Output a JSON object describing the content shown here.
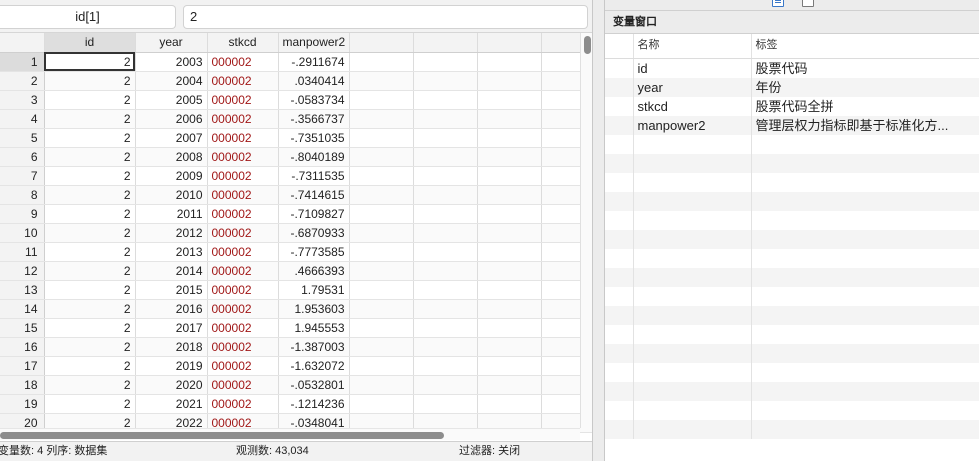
{
  "editor": {
    "cell_name": "id[1]",
    "cell_value": "2",
    "columns": [
      "id",
      "year",
      "stkcd",
      "manpower2"
    ],
    "rows": [
      {
        "n": "1",
        "id": "2",
        "year": "2003",
        "stkcd": "000002",
        "manpower2": "-.2911674"
      },
      {
        "n": "2",
        "id": "2",
        "year": "2004",
        "stkcd": "000002",
        "manpower2": ".0340414"
      },
      {
        "n": "3",
        "id": "2",
        "year": "2005",
        "stkcd": "000002",
        "manpower2": "-.0583734"
      },
      {
        "n": "4",
        "id": "2",
        "year": "2006",
        "stkcd": "000002",
        "manpower2": "-.3566737"
      },
      {
        "n": "5",
        "id": "2",
        "year": "2007",
        "stkcd": "000002",
        "manpower2": "-.7351035"
      },
      {
        "n": "6",
        "id": "2",
        "year": "2008",
        "stkcd": "000002",
        "manpower2": "-.8040189"
      },
      {
        "n": "7",
        "id": "2",
        "year": "2009",
        "stkcd": "000002",
        "manpower2": "-.7311535"
      },
      {
        "n": "8",
        "id": "2",
        "year": "2010",
        "stkcd": "000002",
        "manpower2": "-.7414615"
      },
      {
        "n": "9",
        "id": "2",
        "year": "2011",
        "stkcd": "000002",
        "manpower2": "-.7109827"
      },
      {
        "n": "10",
        "id": "2",
        "year": "2012",
        "stkcd": "000002",
        "manpower2": "-.6870933"
      },
      {
        "n": "11",
        "id": "2",
        "year": "2013",
        "stkcd": "000002",
        "manpower2": "-.7773585"
      },
      {
        "n": "12",
        "id": "2",
        "year": "2014",
        "stkcd": "000002",
        "manpower2": ".4666393"
      },
      {
        "n": "13",
        "id": "2",
        "year": "2015",
        "stkcd": "000002",
        "manpower2": "1.79531"
      },
      {
        "n": "14",
        "id": "2",
        "year": "2016",
        "stkcd": "000002",
        "manpower2": "1.953603"
      },
      {
        "n": "15",
        "id": "2",
        "year": "2017",
        "stkcd": "000002",
        "manpower2": "1.945553"
      },
      {
        "n": "16",
        "id": "2",
        "year": "2018",
        "stkcd": "000002",
        "manpower2": "-1.387003"
      },
      {
        "n": "17",
        "id": "2",
        "year": "2019",
        "stkcd": "000002",
        "manpower2": "-1.632072"
      },
      {
        "n": "18",
        "id": "2",
        "year": "2020",
        "stkcd": "000002",
        "manpower2": "-.0532801"
      },
      {
        "n": "19",
        "id": "2",
        "year": "2021",
        "stkcd": "000002",
        "manpower2": "-.1214236"
      },
      {
        "n": "20",
        "id": "2",
        "year": "2022",
        "stkcd": "000002",
        "manpower2": "-.0348041"
      }
    ],
    "colors": {
      "string_value": "#a11818"
    }
  },
  "status": {
    "vars": "变量数: 4  列序: 数据集",
    "obs": "观测数: 43,034",
    "filter": "过滤器: 关闭"
  },
  "variables_window": {
    "title": "变量窗口",
    "header_name": "名称",
    "header_label": "标签",
    "icons": [
      "document-icon",
      "square-icon"
    ],
    "vars": [
      {
        "name": "id",
        "label": "股票代码"
      },
      {
        "name": "year",
        "label": "年份"
      },
      {
        "name": "stkcd",
        "label": "股票代码全拼"
      },
      {
        "name": "manpower2",
        "label": "管理层权力指标即基于标准化方..."
      }
    ]
  }
}
